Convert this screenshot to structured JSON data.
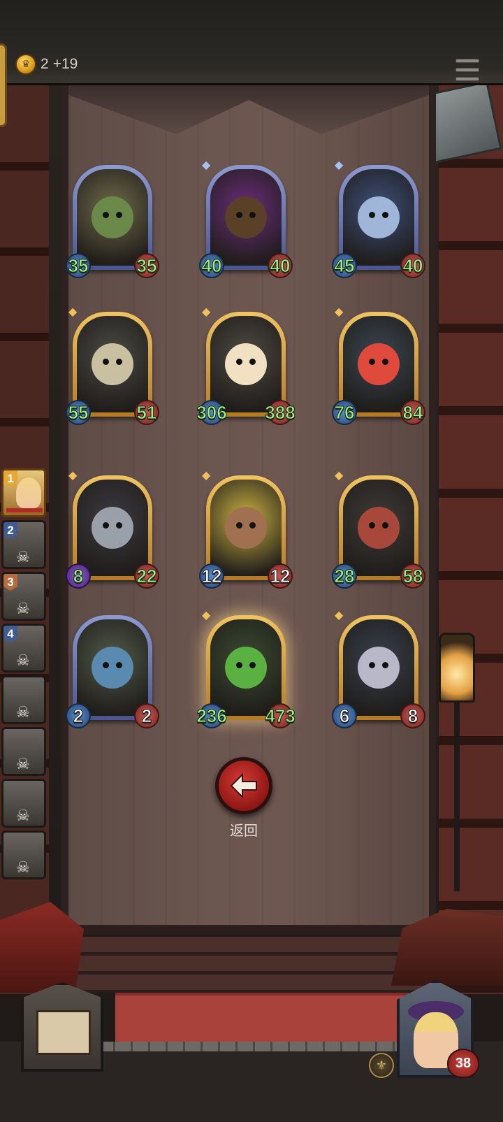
{
  "header": {
    "gold_amount": "2",
    "gold_income": "+19",
    "coin_icon": "crown-coin-icon",
    "menu_icon": "hamburger-menu-icon"
  },
  "cards": [
    {
      "attack": "35",
      "health": "35",
      "frame": "blue",
      "portrait_color": "#6f6a4a",
      "face_color": "#6b8a4a"
    },
    {
      "attack": "40",
      "health": "40",
      "frame": "blue",
      "portrait_color": "#6a2d7a",
      "face_color": "#5a4026"
    },
    {
      "attack": "45",
      "health": "40",
      "frame": "blue",
      "portrait_color": "#3e4f7a",
      "face_color": "#9fb6d8"
    },
    {
      "attack": "55",
      "health": "51",
      "frame": "gold",
      "portrait_color": "#4a4a44",
      "face_color": "#c8c0a0"
    },
    {
      "attack": "306",
      "health": "388",
      "frame": "gold",
      "portrait_color": "#4c4a42",
      "face_color": "#f2e0c2"
    },
    {
      "attack": "76",
      "health": "84",
      "frame": "gold",
      "portrait_color": "#3a4650",
      "face_color": "#e04a3c"
    },
    {
      "attack": "8",
      "health": "22",
      "frame": "gold",
      "portrait_color": "#3c3a40",
      "face_color": "#9aa0aa"
    },
    {
      "attack": "12",
      "health": "12",
      "frame": "gold",
      "portrait_color": "#c8b040",
      "face_color": "#a07050"
    },
    {
      "attack": "28",
      "health": "58",
      "frame": "gold",
      "portrait_color": "#3e3a38",
      "face_color": "#a8483a"
    },
    {
      "attack": "2",
      "health": "2",
      "frame": "blue",
      "portrait_color": "#505a48",
      "face_color": "#5a8ab0"
    },
    {
      "attack": "236",
      "health": "473",
      "frame": "gold",
      "portrait_color": "#3a4a30",
      "face_color": "#5ab040"
    },
    {
      "attack": "6",
      "health": "8",
      "frame": "gold",
      "portrait_color": "#38404c",
      "face_color": "#b8b8c8"
    }
  ],
  "back_button": {
    "label": "返回",
    "icon": "arrow-left-icon"
  },
  "roster": [
    {
      "rank": "1",
      "state": "player"
    },
    {
      "rank": "2",
      "state": "eliminated"
    },
    {
      "rank": "3",
      "state": "eliminated"
    },
    {
      "rank": "4",
      "state": "eliminated"
    },
    {
      "rank": "",
      "state": "eliminated"
    },
    {
      "rank": "",
      "state": "eliminated"
    },
    {
      "rank": "",
      "state": "eliminated"
    },
    {
      "rank": "",
      "state": "eliminated"
    }
  ],
  "hero": {
    "health": "38"
  }
}
